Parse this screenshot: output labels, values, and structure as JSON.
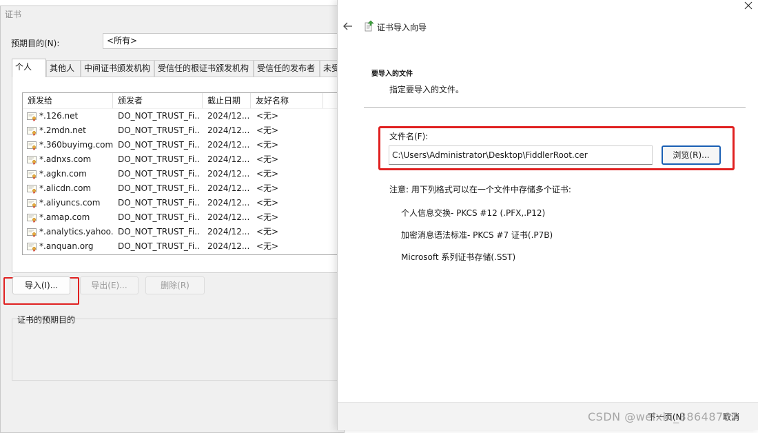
{
  "cert_window": {
    "title": "证书",
    "purpose_label": "预期目的(N):",
    "purpose_value": "<所有>",
    "tabs": [
      "个人",
      "其他人",
      "中间证书颁发机构",
      "受信任的根证书颁发机构",
      "受信任的发布者",
      "未受"
    ],
    "columns": [
      "颁发给",
      "颁发者",
      "截止日期",
      "友好名称"
    ],
    "rows": [
      {
        "issued_to": "*.126.net",
        "issuer": "DO_NOT_TRUST_Fi...",
        "expires": "2024/12...",
        "friendly": "<无>"
      },
      {
        "issued_to": "*.2mdn.net",
        "issuer": "DO_NOT_TRUST_Fi...",
        "expires": "2024/12...",
        "friendly": "<无>"
      },
      {
        "issued_to": "*.360buyimg.com",
        "issuer": "DO_NOT_TRUST_Fi...",
        "expires": "2024/12...",
        "friendly": "<无>"
      },
      {
        "issued_to": "*.adnxs.com",
        "issuer": "DO_NOT_TRUST_Fi...",
        "expires": "2024/12...",
        "friendly": "<无>"
      },
      {
        "issued_to": "*.agkn.com",
        "issuer": "DO_NOT_TRUST_Fi...",
        "expires": "2024/12...",
        "friendly": "<无>"
      },
      {
        "issued_to": "*.alicdn.com",
        "issuer": "DO_NOT_TRUST_Fi...",
        "expires": "2024/12...",
        "friendly": "<无>"
      },
      {
        "issued_to": "*.aliyuncs.com",
        "issuer": "DO_NOT_TRUST_Fi...",
        "expires": "2024/12...",
        "friendly": "<无>"
      },
      {
        "issued_to": "*.amap.com",
        "issuer": "DO_NOT_TRUST_Fi...",
        "expires": "2024/12...",
        "friendly": "<无>"
      },
      {
        "issued_to": "*.analytics.yahoo...",
        "issuer": "DO_NOT_TRUST_Fi...",
        "expires": "2024/12...",
        "friendly": "<无>"
      },
      {
        "issued_to": "*.anquan.org",
        "issuer": "DO_NOT_TRUST_Fi...",
        "expires": "2024/12...",
        "friendly": "<无>"
      }
    ],
    "buttons": {
      "import": "导入(I)...",
      "export": "导出(E)...",
      "remove": "删除(R)"
    },
    "purpose_group_label": "证书的预期目的"
  },
  "wizard": {
    "title": "证书导入向导",
    "heading": "要导入的文件",
    "subheading": "指定要导入的文件。",
    "file_label": "文件名(F):",
    "file_value": "C:\\Users\\Administrator\\Desktop\\FiddlerRoot.cer",
    "browse_label": "浏览(R)...",
    "note": "注意: 用下列格式可以在一个文件中存储多个证书:",
    "formats": [
      "个人信息交换- PKCS #12 (.PFX,.P12)",
      "加密消息语法标准- PKCS #7 证书(.P7B)",
      "Microsoft 系列证书存储(.SST)"
    ],
    "next_label": "下一页(N)",
    "cancel_label": "取消"
  },
  "watermark": "CSDN @weixin_38648767",
  "colors": {
    "highlight": "#e02020",
    "focus_border": "#1a5fb4"
  },
  "icons": [
    "certificate-icon",
    "back-arrow-icon",
    "close-icon",
    "wizard-icon"
  ]
}
